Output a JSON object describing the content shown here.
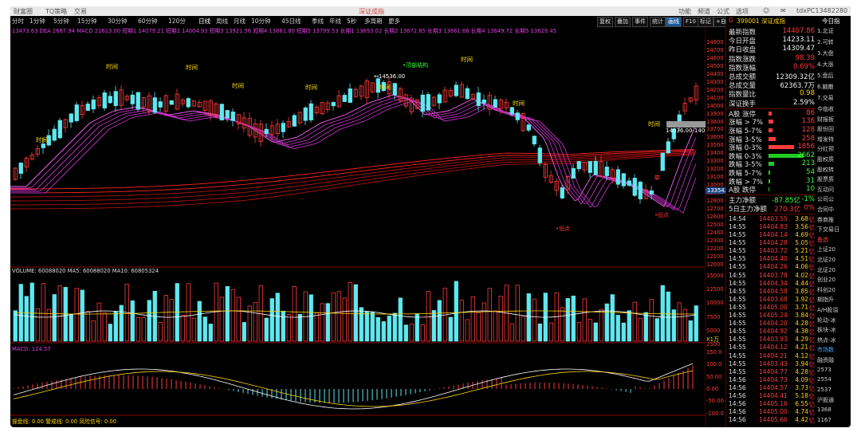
{
  "menubar": {
    "items": [
      "财富圈",
      "TQ策略",
      "交易",
      "深证成指",
      "功能",
      "频道",
      "公式",
      "选项",
      "帮助",
      "tdxPC1348228​0"
    ]
  },
  "toolbar": {
    "periods": [
      "分时",
      "1分钟",
      "5分钟",
      "15分钟",
      "30分钟",
      "60分钟",
      "120分",
      "日线",
      "周线",
      "月线",
      "10分钟",
      "45日线",
      "季线",
      "年线",
      "5秒",
      "多周期",
      "更多"
    ],
    "active_period": "日线",
    "buttons": [
      "复权",
      "叠加",
      "事件",
      "统计",
      "画线",
      "F10",
      "标记",
      "+自选",
      "返回"
    ]
  },
  "header": {
    "ma_text": "MA5: 13842.20  MA10: 13974.71  MA20: 14022.89  MA60: 13888.98",
    "macd_line": "13473.63  DEA 2687.94  MACD 21613.00  短期1 14079.21  短期2 14004.93  短期3 13921.56  短期4 13861.80  短期5 13799.53  长期1 13693.02  长期2 13672.85  长期3 13661.66  长期4 13649.72  长期5 13629.45"
  },
  "vol_label": "VOLUME: 60088020  MA5: 60088020  MA10: 60805324",
  "macd_label": "MACD: 124.57",
  "bottom_label": "操盘线: 0.00  警戒线: 0.00  风险信号: 0.00",
  "chart_labels": {
    "time": "时间",
    "structure": "•顶部结构",
    "low": "•低点",
    "peak": "14536.00",
    "price": "14036.00-140"
  },
  "price_axis": [
    "14800",
    "14700",
    "14600",
    "14500",
    "14400",
    "14300",
    "14200",
    "14100",
    "14000",
    "13900",
    "13800",
    "13700",
    "13600",
    "13500",
    "13400",
    "13300",
    "13200",
    "13100",
    "13000",
    "12900",
    "12800",
    "12700",
    "12600",
    "12500",
    "12400",
    "12300",
    "12200",
    "12100",
    "12000"
  ],
  "price_badge": "13354.6",
  "vol_axis": [
    "15000",
    "12500",
    "10000",
    "7500",
    "5000",
    "2500"
  ],
  "vol_unit": "X1万",
  "macd_axis": [
    "150.0",
    "100.0",
    "50.00",
    "0.00",
    "-50.00",
    "-100.0"
  ],
  "right_panel": {
    "title": "399001 深证成指",
    "top_right": "今日指",
    "stats": [
      {
        "label": "最新指数",
        "value": "14407.86",
        "cls": "up"
      },
      {
        "label": "今日开盘",
        "value": "14233.11",
        "cls": "wh"
      },
      {
        "label": "昨日收盘",
        "value": "14309.47",
        "cls": "wh"
      },
      {
        "label": "指数涨跌",
        "value": "98.39",
        "cls": "up"
      },
      {
        "label": "指数涨幅",
        "value": "0.69%",
        "cls": "up"
      },
      {
        "label": "总成交额",
        "value": "12309.32亿",
        "cls": "wh"
      },
      {
        "label": "总成交量",
        "value": "62363.7万",
        "cls": "wh"
      },
      {
        "label": "指数量比",
        "value": "0.98",
        "cls": "yl"
      },
      {
        "label": "深证换手",
        "value": "2.59%",
        "cls": "wh"
      }
    ],
    "dist": [
      {
        "label": "A股 涨停",
        "value": "86",
        "cls": "up",
        "bar": 4,
        "color": "#ff3b3b"
      },
      {
        "label": "涨幅 > 7%",
        "value": "136",
        "cls": "up",
        "bar": 6,
        "color": "#ff3b3b"
      },
      {
        "label": "涨幅 5-7%",
        "value": "128",
        "cls": "up",
        "bar": 5,
        "color": "#ff3b3b"
      },
      {
        "label": "涨幅 3-5%",
        "value": "258",
        "cls": "up",
        "bar": 9,
        "color": "#ff3b3b"
      },
      {
        "label": "涨幅 0-3%",
        "value": "1856",
        "cls": "up",
        "bar": 32,
        "color": "#ff3b3b"
      },
      {
        "label": "跌幅 0-3%",
        "value": "2662",
        "cls": "dn",
        "bar": 44,
        "color": "#22cc22"
      },
      {
        "label": "跌幅 3-5%",
        "value": "213",
        "cls": "dn",
        "bar": 7,
        "color": "#22cc22"
      },
      {
        "label": "跌幅 5-7%",
        "value": "54",
        "cls": "dn",
        "bar": 2,
        "color": "#22cc22"
      },
      {
        "label": "跌幅 > 7%",
        "value": "31",
        "cls": "dn",
        "bar": 2,
        "color": "#22cc22"
      },
      {
        "label": "A股 跌停",
        "value": "10",
        "cls": "dn",
        "bar": 1,
        "color": "#22cc22"
      }
    ],
    "flows": [
      {
        "label": "主力净额",
        "value": "-87.85亿",
        "pct": "-1%",
        "cls": "dn"
      },
      {
        "label": "5日主力净额",
        "value": "270.3亿",
        "pct": "0%",
        "cls": "up"
      }
    ],
    "ticks": [
      [
        "14:54",
        "14403.55",
        "3.68"
      ],
      [
        "14:55",
        "14404.83",
        "3.56"
      ],
      [
        "14:55",
        "14404.14",
        "4.69"
      ],
      [
        "14:55",
        "14404.28",
        "5.05"
      ],
      [
        "14:55",
        "14403.72",
        "5.21"
      ],
      [
        "14:55",
        "14404.40",
        "4.51"
      ],
      [
        "14:55",
        "14404.26",
        "4.06"
      ],
      [
        "14:55",
        "14403.78",
        "4.02"
      ],
      [
        "14:55",
        "14404.34",
        "4.44"
      ],
      [
        "14:55",
        "14404.58",
        "3.85"
      ],
      [
        "14:55",
        "14403.68",
        "3.92"
      ],
      [
        "14:55",
        "14405.00",
        "3.71"
      ],
      [
        "14:55",
        "14405.24",
        "3.84"
      ],
      [
        "14:55",
        "14404.20",
        "4.28"
      ],
      [
        "14:55",
        "14404.92",
        "4.38"
      ],
      [
        "14:55",
        "14403.93",
        "4.29"
      ],
      [
        "14:55",
        "14404.12",
        "4.21"
      ],
      [
        "14:55",
        "14404.21",
        "4.12"
      ],
      [
        "14:55",
        "14403.43",
        "3.94"
      ],
      [
        "14:55",
        "14404.77",
        "4.28"
      ],
      [
        "14:56",
        "14404.73",
        "4.09"
      ],
      [
        "14:56",
        "14404.57",
        "3.73"
      ],
      [
        "14:56",
        "14404.41",
        "5.18"
      ],
      [
        "14:56",
        "14405.16",
        "6.55"
      ],
      [
        "14:56",
        "14405.00",
        "4.74"
      ],
      [
        "14:56",
        "14405.66",
        "4.42"
      ],
      [
        "14:56",
        "14404.46",
        "4.60"
      ]
    ],
    "tick_unit": "亿",
    "side": [
      "1.北证",
      "2.可转",
      "3.大盘",
      "4.大涨",
      "5.盘后",
      "6.脑散",
      "7.交易",
      "今临收",
      "财报板",
      "股份回",
      "增发特",
      "分红预",
      "股权质",
      "股权转",
      "股票质",
      "互动问",
      "公司公",
      "合同中",
      "券商推",
      "下交易日",
      "备选",
      "上证20",
      "北证20",
      "北证20",
      "创业20",
      "科创20",
      "期指升",
      "A/H股溢",
      "轮动-冰",
      "板块-冰",
      "热点-冰",
      "市场数",
      "融资融",
      "2573",
      "2554",
      "2537",
      "沪股通",
      "1368",
      "1167"
    ]
  },
  "colors": {
    "up": "#ff3b3b",
    "down": "#5fe8f0",
    "bg": "#000000",
    "accent": "#ffd400"
  }
}
